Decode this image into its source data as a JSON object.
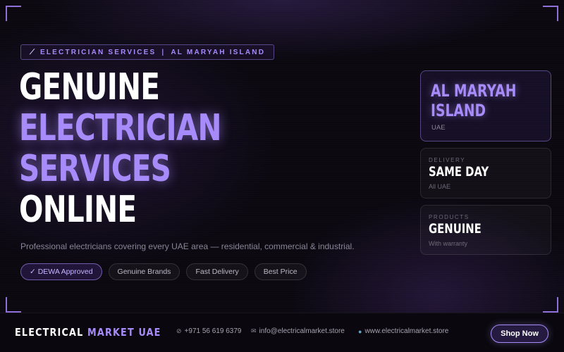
{
  "eyebrow": {
    "service": "ELECTRICIAN SERVICES",
    "separator": "|",
    "location": "AL MARYAH ISLAND"
  },
  "headline": {
    "line1": "GENUINE",
    "line2": "ELECTRICIAN",
    "line3": "SERVICES",
    "line4": "ONLINE"
  },
  "subtitle": "Professional electricians covering every UAE area — residential, commercial & industrial.",
  "chips": [
    "✓ DEWA Approved",
    "Genuine Brands",
    "Fast Delivery",
    "Best Price"
  ],
  "location_card": {
    "title_line1": "AL MARYAH",
    "title_line2": "ISLAND",
    "country": "UAE"
  },
  "info_cards": [
    {
      "label": "DELIVERY",
      "value": "SAME DAY",
      "note": "All UAE"
    },
    {
      "label": "PRODUCTS",
      "value": "GENUINE",
      "note": "With warranty"
    }
  ],
  "footer": {
    "brand_white": "ELECTRICAL",
    "brand_purple": "MARKET UAE",
    "phone": "+971 56 619 6379",
    "email": "info@electricalmarket.store",
    "website": "www.electricalmarket.store",
    "cta": "Shop Now"
  },
  "colors": {
    "accent": "#a78bfa",
    "background": "#0b0810",
    "footer": "#0a080e"
  },
  "icons": {
    "eyebrow": "bolt-icon",
    "phone": "phone-icon",
    "email": "mail-icon",
    "website": "globe-icon"
  }
}
